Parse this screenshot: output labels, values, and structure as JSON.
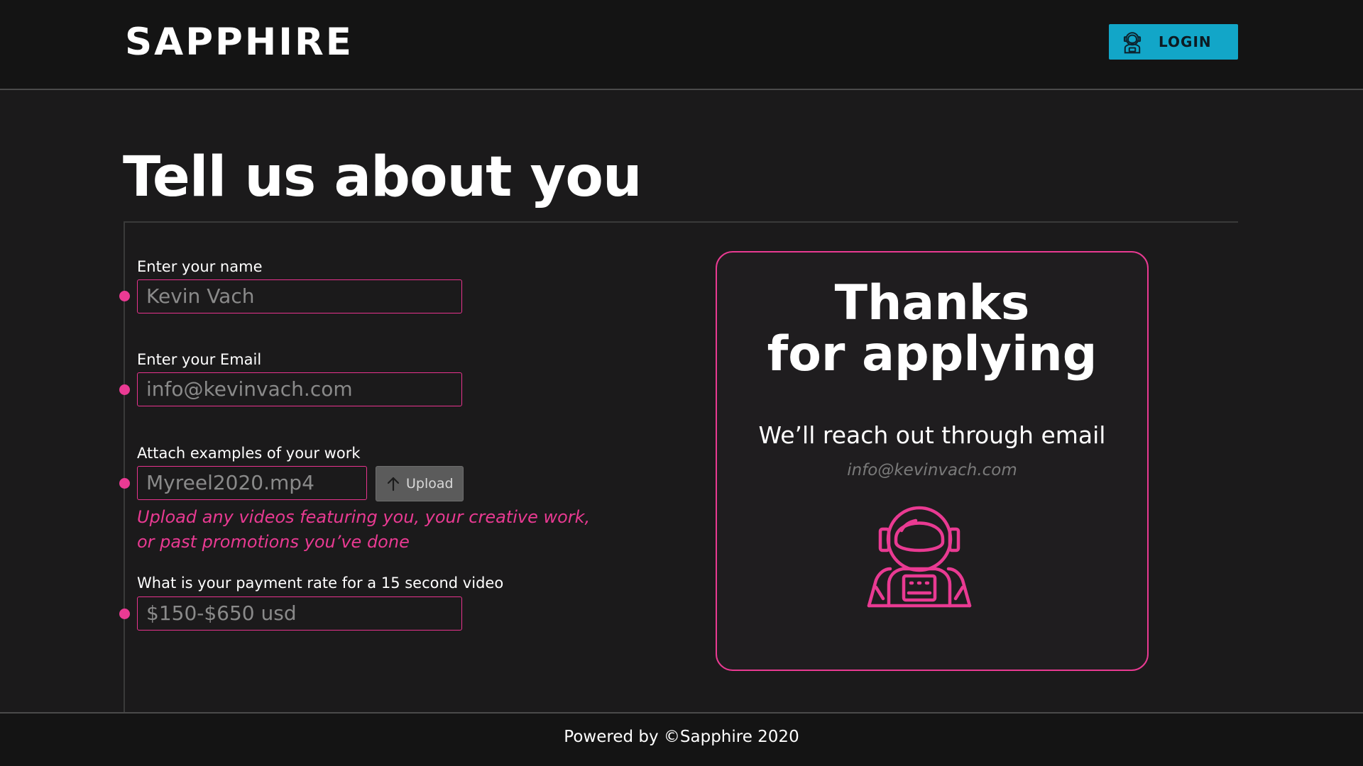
{
  "header": {
    "logo": "SAPPHIRE",
    "login_label": "LOGIN"
  },
  "page": {
    "title": "Tell us about you"
  },
  "form": {
    "name_label": "Enter your name",
    "name_value": "Kevin Vach",
    "email_label": "Enter your Email",
    "email_value": "info@kevinvach.com",
    "work_label": "Attach examples of your work",
    "work_value": "Myreel2020.mp4",
    "upload_label": "Upload",
    "upload_hint_line1": "Upload any videos featuring you, your creative work,",
    "upload_hint_line2": "or past promotions you’ve done",
    "rate_label": "What is your payment rate for a 15 second video",
    "rate_value": "$150-$650 usd"
  },
  "card": {
    "title_line1": "Thanks",
    "title_line2": "for applying",
    "subtitle": "We’ll reach out through email",
    "email": "info@kevinvach.com",
    "icon": "astronaut-icon"
  },
  "footer": {
    "text": "Powered by ©Sapphire 2020"
  },
  "colors": {
    "accent_pink": "#e93a92",
    "login_blue": "#12a6c8",
    "background": "#1b1a1b",
    "header_bg": "#141414"
  }
}
